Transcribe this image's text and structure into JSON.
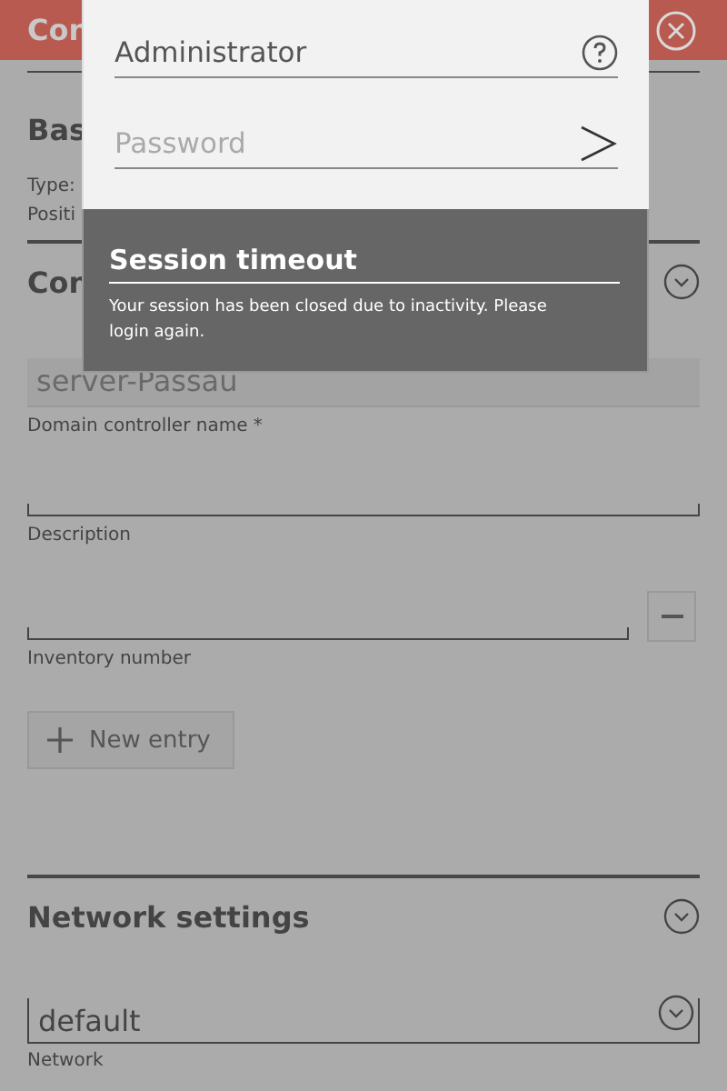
{
  "header": {
    "title": "Con"
  },
  "basic": {
    "title": "Bas",
    "lines": [
      "Type:",
      "Positi"
    ]
  },
  "config": {
    "title": "Con",
    "fields": [
      {
        "kind": "disabled",
        "value": "server-Passau",
        "label": "Domain controller name *"
      },
      {
        "kind": "text",
        "label": "Description"
      },
      {
        "kind": "removable",
        "label": "Inventory number"
      }
    ],
    "new_entry_button": "New entry"
  },
  "network": {
    "title": "Network settings",
    "value": "default",
    "label": "Network"
  },
  "login": {
    "username": "Administrator",
    "password_placeholder": "Password"
  },
  "notice": {
    "title": "Session timeout",
    "text": "Your session has been closed due to inactivity. Please login again."
  }
}
